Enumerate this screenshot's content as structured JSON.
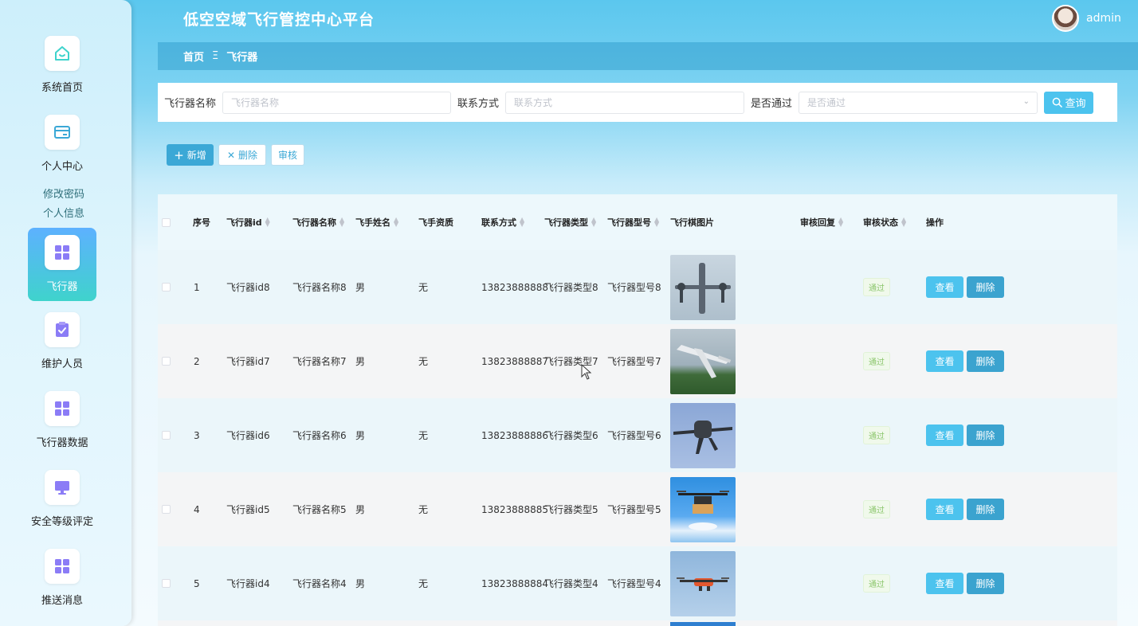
{
  "app": {
    "title": "低空空域飞行管控中心平台",
    "username": "admin"
  },
  "sidebar": {
    "items": [
      {
        "label": "系统首页",
        "icon": "home-icon"
      },
      {
        "label": "个人中心",
        "icon": "card-icon"
      },
      {
        "label": "飞行器",
        "icon": "grid-icon",
        "active": true
      },
      {
        "label": "维护人员",
        "icon": "clipboard-check-icon"
      },
      {
        "label": "飞行器数据",
        "icon": "grid-icon"
      },
      {
        "label": "安全等级评定",
        "icon": "monitor-icon"
      },
      {
        "label": "推送消息",
        "icon": "grid-icon"
      }
    ],
    "sub_links": [
      "修改密码",
      "个人信息"
    ]
  },
  "breadcrumb": {
    "home": "首页",
    "separator": "Ξ",
    "current": "飞行器"
  },
  "search": {
    "name_label": "飞行器名称",
    "name_placeholder": "飞行器名称",
    "contact_label": "联系方式",
    "contact_placeholder": "联系方式",
    "pass_label": "是否通过",
    "pass_placeholder": "是否通过",
    "query_label": "查询"
  },
  "toolbar": {
    "add_label": "新增",
    "delete_label": "删除",
    "audit_label": "审核"
  },
  "table": {
    "headers": [
      "序号",
      "飞行器id",
      "飞行器名称",
      "飞手姓名",
      "飞手资质",
      "联系方式",
      "飞行器类型",
      "飞行器型号",
      "飞行棋图片",
      "审核回复",
      "审核状态",
      "操作"
    ],
    "rows": [
      {
        "index": "1",
        "id": "飞行器id8",
        "name": "飞行器名称8",
        "pilot": "男",
        "qual": "无",
        "phone": "13823888888",
        "type": "飞行器类型8",
        "model": "飞行器型号8",
        "reply": "",
        "status": "通过"
      },
      {
        "index": "2",
        "id": "飞行器id7",
        "name": "飞行器名称7",
        "pilot": "男",
        "qual": "无",
        "phone": "13823888887",
        "type": "飞行器类型7",
        "model": "飞行器型号7",
        "reply": "",
        "status": "通过"
      },
      {
        "index": "3",
        "id": "飞行器id6",
        "name": "飞行器名称6",
        "pilot": "男",
        "qual": "无",
        "phone": "13823888886",
        "type": "飞行器类型6",
        "model": "飞行器型号6",
        "reply": "",
        "status": "通过"
      },
      {
        "index": "4",
        "id": "飞行器id5",
        "name": "飞行器名称5",
        "pilot": "男",
        "qual": "无",
        "phone": "13823888885",
        "type": "飞行器类型5",
        "model": "飞行器型号5",
        "reply": "",
        "status": "通过"
      },
      {
        "index": "5",
        "id": "飞行器id4",
        "name": "飞行器名称4",
        "pilot": "男",
        "qual": "无",
        "phone": "13823888884",
        "type": "飞行器类型4",
        "model": "飞行器型号4",
        "reply": "",
        "status": "通过"
      }
    ],
    "view_label": "查看",
    "delete_label": "删除"
  },
  "colors": {
    "accent": "#4cc3ee",
    "header_gradient_top": "#5bc7ee",
    "status_green": "#8bc66c"
  }
}
